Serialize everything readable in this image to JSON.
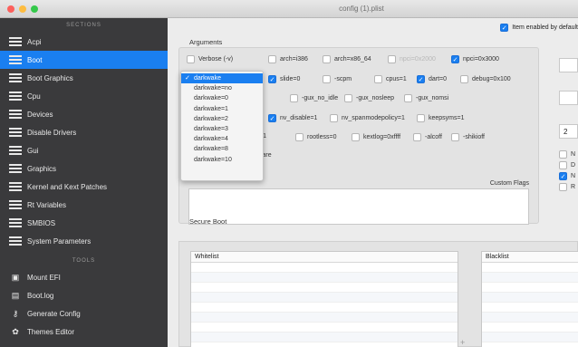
{
  "window": {
    "title": "config (1).plist"
  },
  "sidebar": {
    "sections_title": "SECTIONS",
    "items": [
      {
        "label": "Acpi"
      },
      {
        "label": "Boot"
      },
      {
        "label": "Boot Graphics"
      },
      {
        "label": "Cpu"
      },
      {
        "label": "Devices"
      },
      {
        "label": "Disable Drivers"
      },
      {
        "label": "Gui"
      },
      {
        "label": "Graphics"
      },
      {
        "label": "Kernel and Kext Patches"
      },
      {
        "label": "Rt Variables"
      },
      {
        "label": "SMBIOS"
      },
      {
        "label": "System Parameters"
      }
    ],
    "active_index": 1,
    "tools_title": "TOOLS",
    "tools": [
      {
        "label": "Mount EFI",
        "icon": "disk-icon"
      },
      {
        "label": "Boot.log",
        "icon": "log-icon"
      },
      {
        "label": "Generate Config",
        "icon": "key-icon"
      },
      {
        "label": "Themes Editor",
        "icon": "palette-icon"
      }
    ]
  },
  "main": {
    "item_enabled_label": "Item enabled by default",
    "arguments_label": "Arguments",
    "flags": [
      {
        "label": "Verbose (-v)",
        "checked": false
      },
      {
        "label": "arch=i386",
        "checked": false
      },
      {
        "label": "arch=x86_64",
        "checked": false
      },
      {
        "label": "npci=0x2000",
        "checked": false,
        "dim": true
      },
      {
        "label": "npci=0x3000",
        "checked": true
      },
      {
        "label": "slide=0",
        "checked": true
      },
      {
        "label": "-scpm",
        "checked": false
      },
      {
        "label": "cpus=1",
        "checked": false
      },
      {
        "label": "dart=0",
        "checked": true
      },
      {
        "label": "debug=0x100",
        "checked": false
      },
      {
        "label": "2",
        "checked": false,
        "nobox": true
      },
      {
        "label": "-gux_no_idle",
        "checked": false
      },
      {
        "label": "-gux_nosleep",
        "checked": false
      },
      {
        "label": "-gux_nomsi",
        "checked": false
      },
      {
        "label": "nv_disable=1",
        "checked": true
      },
      {
        "label": "nv_spanmodepolicy=1",
        "checked": false
      },
      {
        "label": "keepsyms=1",
        "checked": false
      },
      {
        "label": "=1",
        "checked": false,
        "nobox": true
      },
      {
        "label": "rootless=0",
        "checked": false
      },
      {
        "label": "kextlog=0xffff",
        "checked": false
      },
      {
        "label": "-alcoff",
        "checked": false
      },
      {
        "label": "-shikioff",
        "checked": false
      },
      {
        "label": "vare",
        "checked": false,
        "nobox": true
      }
    ],
    "custom_flags_label": "Custom Flags",
    "darkwake_options": [
      "darkwake",
      "darkwake=no",
      "darkwake=0",
      "darkwake=1",
      "darkwake=2",
      "darkwake=3",
      "darkwake=4",
      "darkwake=8",
      "darkwake=10"
    ],
    "darkwake_selected": 0,
    "right_column": {
      "number_value": "2",
      "options": [
        {
          "label": "N",
          "checked": false
        },
        {
          "label": "D",
          "checked": false
        },
        {
          "label": "N",
          "checked": true
        },
        {
          "label": "R",
          "checked": false
        }
      ]
    },
    "secure_boot": {
      "label": "Secure Boot",
      "whitelist_label": "Whitelist",
      "blacklist_label": "Blacklist",
      "add_symbol": "+"
    }
  }
}
